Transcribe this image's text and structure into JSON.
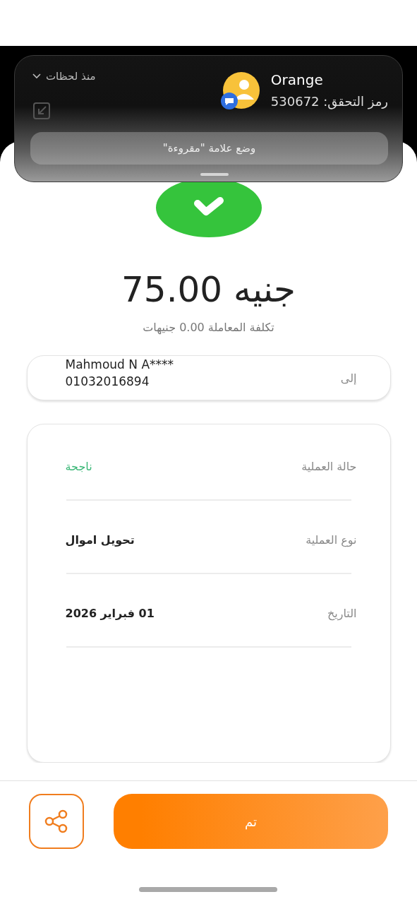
{
  "notification": {
    "sender": "Orange",
    "message": "رمز التحقق: 530672",
    "time": "منذ لحظات",
    "action": "وضع علامة \"مقروءة\""
  },
  "amount": "75.00 جنيه",
  "fee": "تكلفة المعاملة 0.00 جنيهات",
  "recipient": {
    "label": "إلى",
    "name": "Mahmoud N A****",
    "phone": "01032016894"
  },
  "details": [
    {
      "kind": "status",
      "label": "حالة العملية",
      "value": "ناجحة"
    },
    {
      "kind": "plain",
      "label": "نوع العملية",
      "value": "تحويل اموال"
    },
    {
      "kind": "plain",
      "label": "التاريخ",
      "value": "01 فبراير 2026"
    }
  ],
  "done_button": "تم"
}
